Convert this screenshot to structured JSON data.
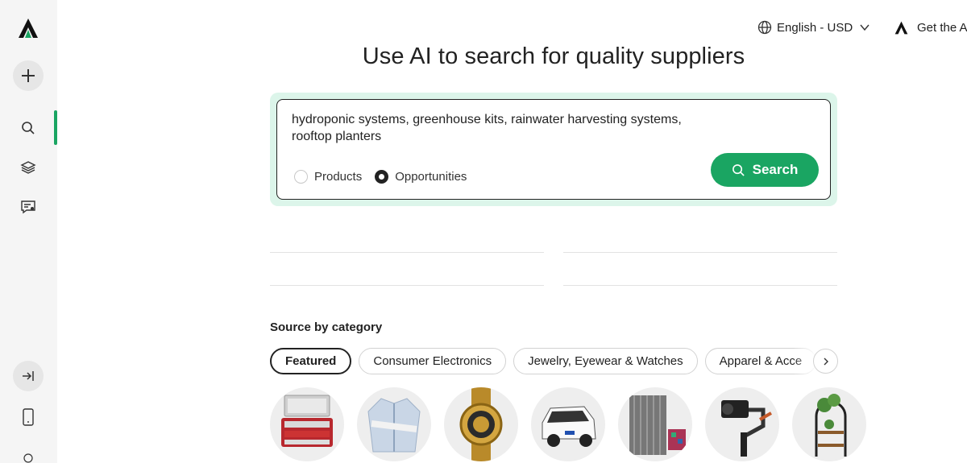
{
  "topbar": {
    "language": "English - USD",
    "get_app": "Get the A"
  },
  "main": {
    "title": "Use AI to search for quality suppliers",
    "search": {
      "query": "hydroponic systems, greenhouse kits, rainwater harvesting systems, rooftop planters",
      "radio_products": "Products",
      "radio_opportunities": "Opportunities",
      "selected_mode": "Opportunities",
      "button": "Search"
    }
  },
  "categories": {
    "heading": "Source by category",
    "chips": [
      "Featured",
      "Consumer Electronics",
      "Jewelry, Eyewear & Watches",
      "Apparel & Acce"
    ],
    "active_chip": "Featured",
    "thumbnails": [
      "makeup-kit-case",
      "jacket",
      "gold-watch",
      "mini-car",
      "curtains",
      "camera-gimbal",
      "plant-stand"
    ]
  },
  "colors": {
    "accent": "#1aa562",
    "search_halo": "#dcf5ea",
    "sidebar_bg": "#f5f5f5"
  }
}
